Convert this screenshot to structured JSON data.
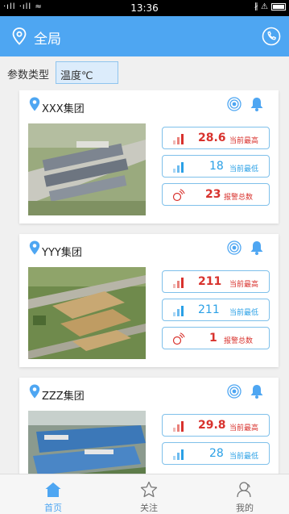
{
  "status_bar": {
    "left": "·ıll ·ıll ≈",
    "time": "13:36",
    "right": "∦ ⚠"
  },
  "header": {
    "title": "全局",
    "accent": "#4ea6f2"
  },
  "filter": {
    "label": "参数类型",
    "value": "温度℃"
  },
  "groups": [
    {
      "name": "XXX集团",
      "max_value": "28.6",
      "max_label": "当前最高",
      "min_value": "18",
      "min_label": "当前最低",
      "alarm_value": "23",
      "alarm_label": "报警总数"
    },
    {
      "name": "YYY集团",
      "max_value": "211",
      "max_label": "当前最高",
      "min_value": "211",
      "min_label": "当前最低",
      "alarm_value": "1",
      "alarm_label": "报警总数"
    },
    {
      "name": "ZZZ集团",
      "max_value": "29.8",
      "max_label": "当前最高",
      "min_value": "28",
      "min_label": "当前最低"
    }
  ],
  "tabs": [
    {
      "label": "首页",
      "icon": "home-icon",
      "active": true
    },
    {
      "label": "关注",
      "icon": "star-icon",
      "active": false
    },
    {
      "label": "我的",
      "icon": "user-icon",
      "active": false
    }
  ],
  "colors": {
    "high": "#d8322d",
    "low": "#2aa0e6",
    "stat_border": "#7fc0ea"
  }
}
